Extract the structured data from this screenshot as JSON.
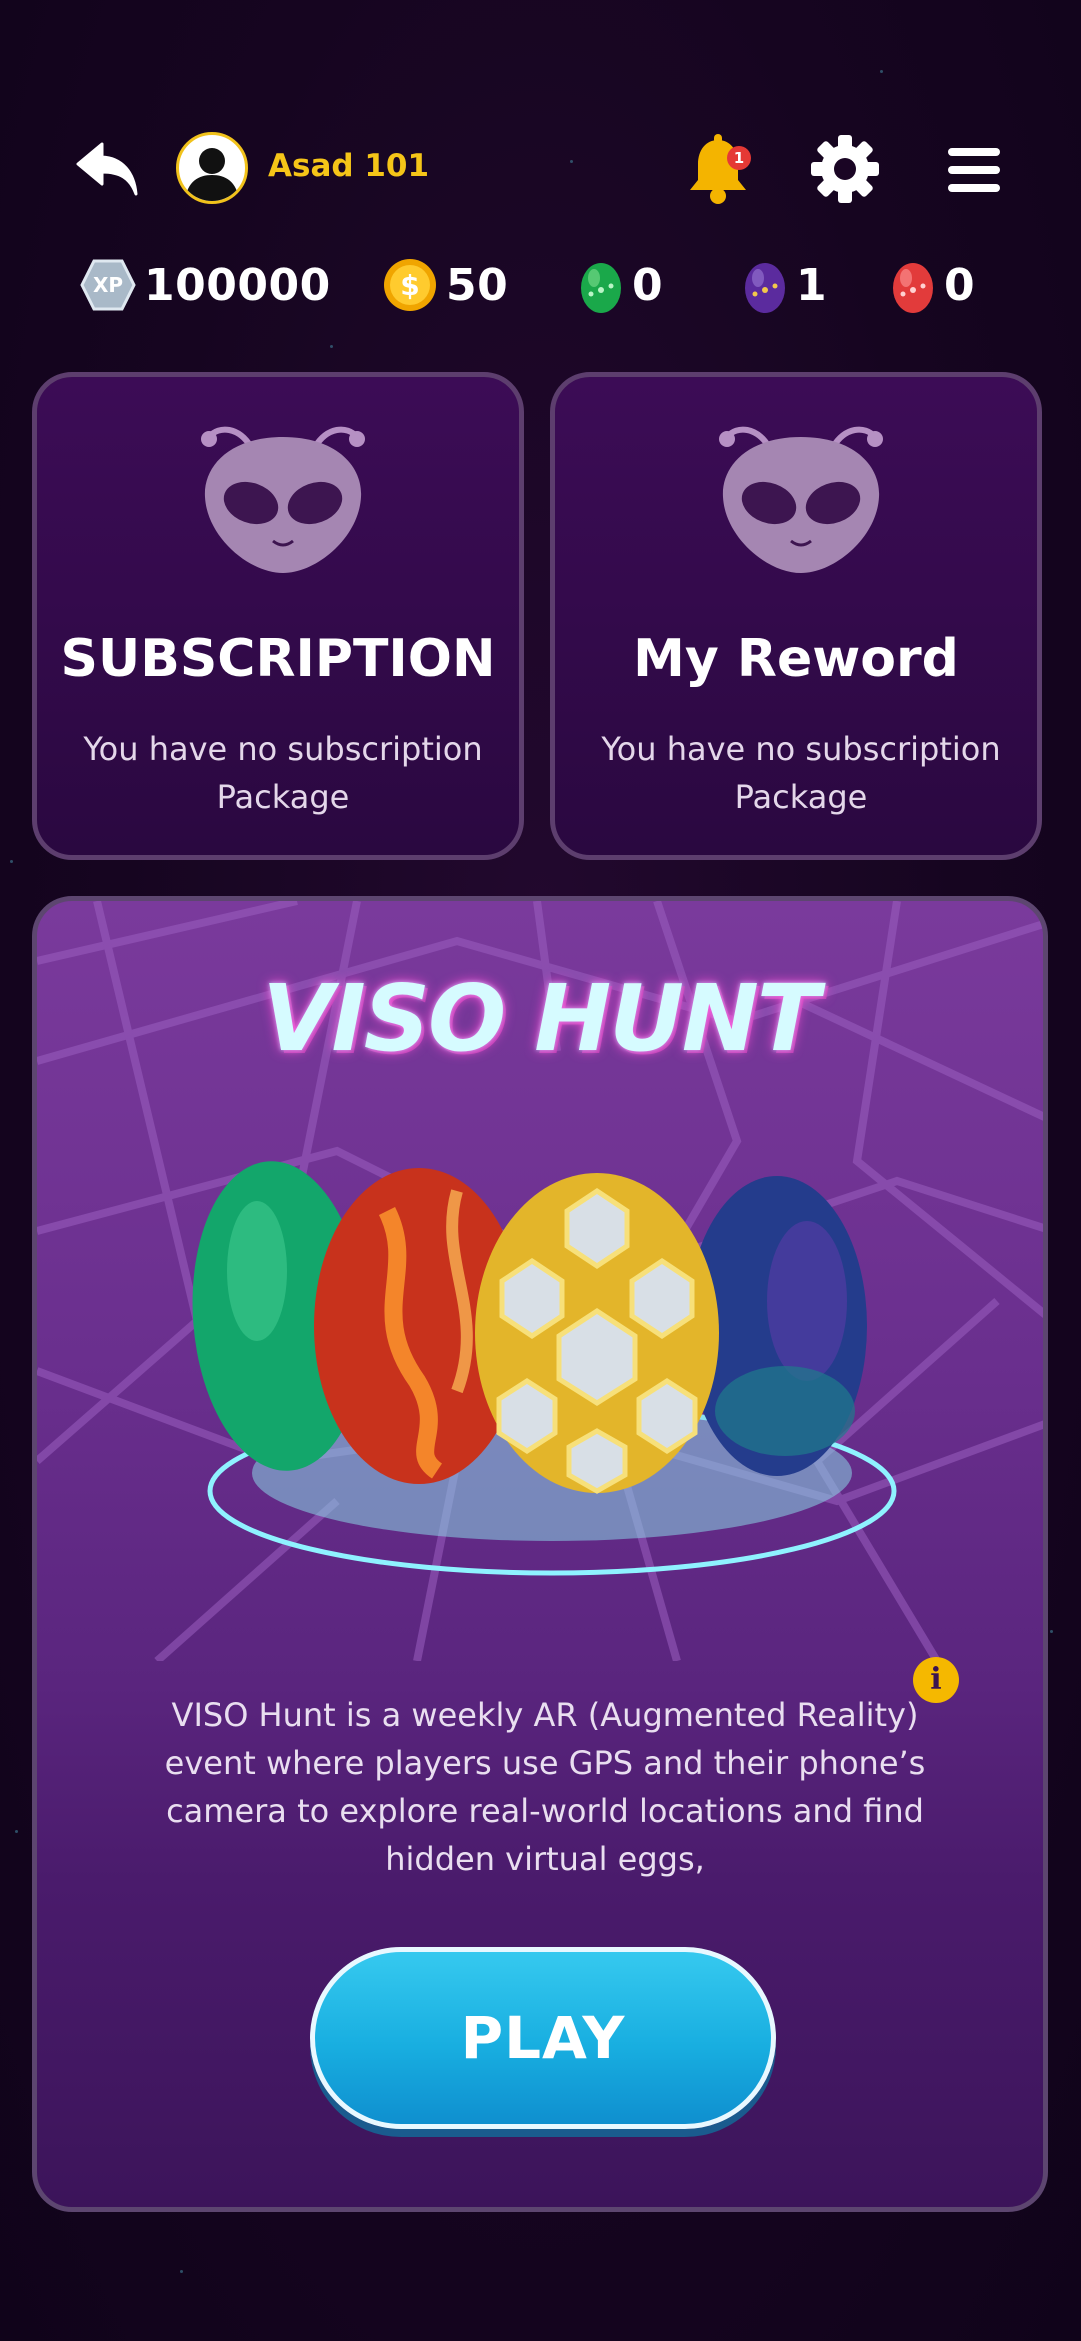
{
  "header": {
    "username": "Asad 101",
    "notification_count": "1"
  },
  "currencies": [
    {
      "icon": "xp-icon",
      "value": "100000"
    },
    {
      "icon": "coin-icon",
      "value": "50"
    },
    {
      "icon": "green-egg-icon",
      "value": "0"
    },
    {
      "icon": "purple-egg-icon",
      "value": "1"
    },
    {
      "icon": "red-egg-icon",
      "value": "0"
    }
  ],
  "cards": [
    {
      "title": "SUBSCRIPTION",
      "description": "You have no subscription Package"
    },
    {
      "title": "My Reword",
      "description": "You have no subscription Package"
    }
  ],
  "hunt": {
    "title": "VISO HUNT",
    "description": "VISO Hunt is a weekly AR (Augmented Reality) event where players use GPS and their phone’s camera to explore real-world locations and find hidden virtual eggs,",
    "play_label": "PLAY"
  },
  "colors": {
    "accent_gold": "#f5c518",
    "play_blue": "#18aee0",
    "panel_purple": "#6a2f8e"
  }
}
